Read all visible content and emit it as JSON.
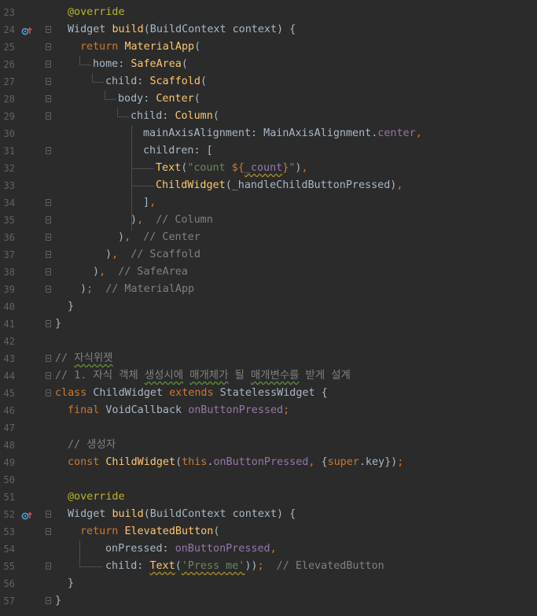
{
  "colors": {
    "background": "#2b2b2b",
    "keyword": "#cc7832",
    "function": "#ffc66d",
    "string": "#6a8759",
    "comment": "#808080",
    "annotation": "#bbb529",
    "field": "#9876aa",
    "text": "#a9b7c6",
    "line_number": "#5f6366"
  },
  "lines": [
    {
      "num": "23",
      "indent": 1,
      "fold": false,
      "icon": "",
      "tokens": [
        [
          "ann",
          "@override"
        ]
      ]
    },
    {
      "num": "24",
      "indent": 1,
      "fold": true,
      "icon": "override-marker-icon",
      "tokens": [
        [
          "type",
          "Widget "
        ],
        [
          "fn",
          "build"
        ],
        [
          "punc",
          "(BuildContext context) {"
        ]
      ]
    },
    {
      "num": "25",
      "indent": 2,
      "fold": true,
      "icon": "",
      "tokens": [
        [
          "kw",
          "return "
        ],
        [
          "fn",
          "MaterialApp"
        ],
        [
          "punc",
          "("
        ]
      ]
    },
    {
      "num": "26",
      "indent": 3,
      "fold": true,
      "icon": "",
      "tokens": [
        [
          "text",
          "home: "
        ],
        [
          "fn",
          "SafeArea"
        ],
        [
          "punc",
          "("
        ]
      ]
    },
    {
      "num": "27",
      "indent": 4,
      "fold": true,
      "icon": "",
      "tokens": [
        [
          "text",
          "child: "
        ],
        [
          "fn",
          "Scaffold"
        ],
        [
          "punc",
          "("
        ]
      ]
    },
    {
      "num": "28",
      "indent": 5,
      "fold": true,
      "icon": "",
      "tokens": [
        [
          "text",
          "body: "
        ],
        [
          "fn",
          "Center"
        ],
        [
          "punc",
          "("
        ]
      ]
    },
    {
      "num": "29",
      "indent": 6,
      "fold": true,
      "icon": "",
      "tokens": [
        [
          "text",
          "child: "
        ],
        [
          "fn",
          "Column"
        ],
        [
          "punc",
          "("
        ]
      ]
    },
    {
      "num": "30",
      "indent": 7,
      "fold": false,
      "icon": "",
      "tokens": [
        [
          "text",
          "mainAxisAlignment: MainAxisAlignment."
        ],
        [
          "field",
          "center"
        ],
        [
          "kw",
          ","
        ]
      ]
    },
    {
      "num": "31",
      "indent": 7,
      "fold": true,
      "icon": "",
      "tokens": [
        [
          "text",
          "children: ["
        ]
      ]
    },
    {
      "num": "32",
      "indent": 8,
      "fold": false,
      "icon": "",
      "tokens": [
        [
          "fn",
          "Text"
        ],
        [
          "punc",
          "("
        ],
        [
          "str",
          "\"count "
        ],
        [
          "kw",
          "${"
        ],
        [
          "fieldu",
          "_count"
        ],
        [
          "kw",
          "}"
        ],
        [
          "str",
          "\""
        ],
        [
          "punc",
          ")"
        ],
        [
          "kw",
          ","
        ]
      ]
    },
    {
      "num": "33",
      "indent": 8,
      "fold": false,
      "icon": "",
      "tokens": [
        [
          "fn",
          "ChildWidget"
        ],
        [
          "punc",
          "(_handleChildButtonPressed)"
        ],
        [
          "kw",
          ","
        ]
      ]
    },
    {
      "num": "34",
      "indent": 7,
      "fold": true,
      "icon": "",
      "tokens": [
        [
          "punc",
          "]"
        ],
        [
          "kw",
          ","
        ]
      ]
    },
    {
      "num": "35",
      "indent": 6,
      "fold": true,
      "icon": "",
      "tokens": [
        [
          "punc",
          ")"
        ],
        [
          "kw",
          ", "
        ],
        [
          "cmt",
          " // Column"
        ]
      ]
    },
    {
      "num": "36",
      "indent": 5,
      "fold": true,
      "icon": "",
      "tokens": [
        [
          "punc",
          ")"
        ],
        [
          "kw",
          ", "
        ],
        [
          "cmt",
          " // Center"
        ]
      ]
    },
    {
      "num": "37",
      "indent": 4,
      "fold": true,
      "icon": "",
      "tokens": [
        [
          "punc",
          ")"
        ],
        [
          "kw",
          ", "
        ],
        [
          "cmt",
          " // Scaffold"
        ]
      ]
    },
    {
      "num": "38",
      "indent": 3,
      "fold": true,
      "icon": "",
      "tokens": [
        [
          "punc",
          ")"
        ],
        [
          "kw",
          ", "
        ],
        [
          "cmt",
          " // SafeArea"
        ]
      ]
    },
    {
      "num": "39",
      "indent": 2,
      "fold": true,
      "icon": "",
      "tokens": [
        [
          "punc",
          ")"
        ],
        [
          "kw",
          "; "
        ],
        [
          "cmt",
          " // MaterialApp"
        ]
      ]
    },
    {
      "num": "40",
      "indent": 1,
      "fold": false,
      "icon": "",
      "tokens": [
        [
          "punc",
          "}"
        ]
      ]
    },
    {
      "num": "41",
      "indent": 0,
      "fold": true,
      "icon": "",
      "tokens": [
        [
          "punc",
          "}"
        ]
      ]
    },
    {
      "num": "42",
      "indent": 0,
      "fold": false,
      "icon": "",
      "tokens": []
    },
    {
      "num": "43",
      "indent": 0,
      "fold": true,
      "icon": "",
      "tokens": [
        [
          "cmt",
          "// "
        ],
        [
          "cmtu",
          "자식위젯"
        ]
      ]
    },
    {
      "num": "44",
      "indent": 0,
      "fold": true,
      "icon": "",
      "tokens": [
        [
          "cmt",
          "// 1. 자식 객체 "
        ],
        [
          "cmtu",
          "생성시에"
        ],
        [
          "cmt",
          " "
        ],
        [
          "cmtu",
          "매개체가"
        ],
        [
          "cmt",
          " 될 "
        ],
        [
          "cmtu",
          "매개변수를"
        ],
        [
          "cmt",
          " 받게 설계"
        ]
      ]
    },
    {
      "num": "45",
      "indent": 0,
      "fold": true,
      "icon": "",
      "tokens": [
        [
          "kw",
          "class "
        ],
        [
          "type",
          "ChildWidget "
        ],
        [
          "kw",
          "extends "
        ],
        [
          "type",
          "StatelessWidget {"
        ]
      ]
    },
    {
      "num": "46",
      "indent": 1,
      "fold": false,
      "icon": "",
      "tokens": [
        [
          "kw",
          "final "
        ],
        [
          "type",
          "VoidCallback "
        ],
        [
          "field",
          "onButtonPressed"
        ],
        [
          "kw",
          ";"
        ]
      ]
    },
    {
      "num": "47",
      "indent": 1,
      "fold": false,
      "icon": "",
      "tokens": []
    },
    {
      "num": "48",
      "indent": 1,
      "fold": false,
      "icon": "",
      "tokens": [
        [
          "cmt",
          "// 생성자"
        ]
      ]
    },
    {
      "num": "49",
      "indent": 1,
      "fold": false,
      "icon": "",
      "tokens": [
        [
          "kw",
          "const "
        ],
        [
          "fn",
          "ChildWidget"
        ],
        [
          "punc",
          "("
        ],
        [
          "kw",
          "this"
        ],
        [
          "punc",
          "."
        ],
        [
          "field",
          "onButtonPressed"
        ],
        [
          "kw",
          ", "
        ],
        [
          "punc",
          "{"
        ],
        [
          "kw",
          "super"
        ],
        [
          "punc",
          ".key})"
        ],
        [
          "kw",
          ";"
        ]
      ]
    },
    {
      "num": "50",
      "indent": 1,
      "fold": false,
      "icon": "",
      "tokens": []
    },
    {
      "num": "51",
      "indent": 1,
      "fold": false,
      "icon": "",
      "tokens": [
        [
          "ann",
          "@override"
        ]
      ]
    },
    {
      "num": "52",
      "indent": 1,
      "fold": true,
      "icon": "override-marker-icon",
      "tokens": [
        [
          "type",
          "Widget "
        ],
        [
          "fn",
          "build"
        ],
        [
          "punc",
          "(BuildContext context) {"
        ]
      ]
    },
    {
      "num": "53",
      "indent": 2,
      "fold": true,
      "icon": "",
      "tokens": [
        [
          "kw",
          "return "
        ],
        [
          "fn",
          "ElevatedButton"
        ],
        [
          "punc",
          "("
        ]
      ]
    },
    {
      "num": "54",
      "indent": 4,
      "fold": false,
      "icon": "",
      "tokens": [
        [
          "text",
          "onPressed: "
        ],
        [
          "field",
          "onButtonPressed"
        ],
        [
          "kw",
          ","
        ]
      ]
    },
    {
      "num": "55",
      "indent": 4,
      "fold": true,
      "icon": "",
      "tokens": [
        [
          "text",
          "child: "
        ],
        [
          "fnu",
          "Text"
        ],
        [
          "punc",
          "("
        ],
        [
          "stru",
          "'Press me'"
        ],
        [
          "punc",
          "))"
        ],
        [
          "kw",
          ";"
        ],
        [
          "cmt",
          "  // ElevatedButton"
        ]
      ]
    },
    {
      "num": "56",
      "indent": 1,
      "fold": false,
      "icon": "",
      "tokens": [
        [
          "punc",
          "}"
        ]
      ]
    },
    {
      "num": "57",
      "indent": 0,
      "fold": true,
      "icon": "",
      "tokens": [
        [
          "punc",
          "}"
        ]
      ]
    }
  ]
}
